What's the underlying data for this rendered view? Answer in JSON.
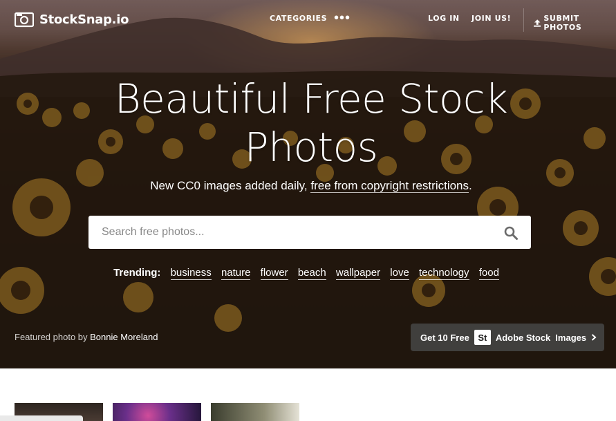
{
  "header": {
    "brand": "StockSnap.io",
    "nav": {
      "categories": "CATEGORIES",
      "more": "•••",
      "login": "LOG IN",
      "join": "JOIN US!",
      "submit": "SUBMIT PHOTOS"
    }
  },
  "hero": {
    "title": "Beautiful Free Stock Photos",
    "subtitle_prefix": "New CC0 images added daily, ",
    "subtitle_link": "free from copyright restrictions",
    "subtitle_suffix": "."
  },
  "search": {
    "placeholder": "Search free photos..."
  },
  "trending": {
    "label": "Trending:",
    "tags": [
      "business",
      "nature",
      "flower",
      "beach",
      "wallpaper",
      "love",
      "technology",
      "food"
    ]
  },
  "credit": {
    "prefix": "Featured photo by ",
    "author": "Bonnie Moreland"
  },
  "adobe_cta": {
    "prefix": "Get 10 Free",
    "logo": "St",
    "brand": "Adobe Stock",
    "suffix": "Images"
  },
  "icons": {
    "logo": "camera-icon",
    "upload": "upload-icon",
    "search": "search-icon",
    "chevron": "chevron-right-icon"
  }
}
